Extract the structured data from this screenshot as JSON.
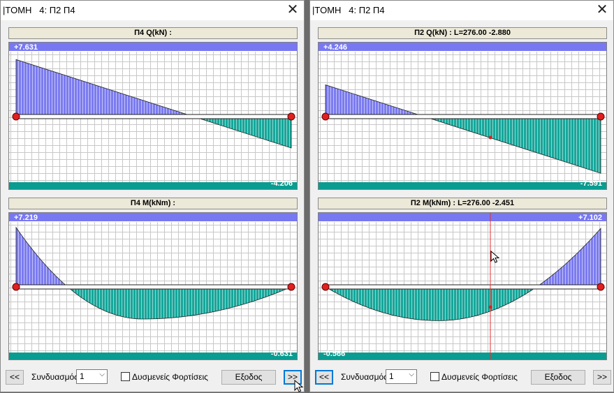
{
  "colors": {
    "blue": "#7b7bf0",
    "teal": "#16a79a",
    "band_blue": "#7878f2",
    "band_teal": "#0a9c90",
    "grid": "#c8c8c8",
    "support": "#e02020",
    "cursor_line": "#e53030"
  },
  "windows": [
    {
      "title": "|ΤΟΜΗ   4: Π2 Π4",
      "close_icon": "close-icon",
      "shear": {
        "header": "Π4 Q(kN) :",
        "top_label": "+7.631",
        "bottom_label": "-4.206"
      },
      "moment": {
        "header": "Π4 M(kNm) :",
        "top_label": "+7.219",
        "bottom_label": "-0.631"
      },
      "controls": {
        "prev": "<<",
        "combo_label": "Συνδυασμός",
        "combo_value": "1",
        "checkbox_label": "Δυσμενείς Φορτίσεις",
        "exit": "Εξοδος",
        "next": ">>"
      }
    },
    {
      "title": "|ΤΟΜΗ   4: Π2 Π4",
      "close_icon": "close-icon",
      "shear": {
        "header": "Π2 Q(kN) : L=276.00 -2.880",
        "top_label": "+4.246",
        "bottom_label": "-7.591"
      },
      "moment": {
        "header": "Π2 M(kNm) : L=276.00 -2.451",
        "top_label": "+7.102",
        "bottom_label": "-0.566"
      },
      "controls": {
        "prev": "<<",
        "combo_label": "Συνδυασμός",
        "combo_value": "1",
        "checkbox_label": "Δυσμενείς Φορτίσεις",
        "exit": "Εξοδος",
        "next": ">>"
      }
    }
  ],
  "chart_data": [
    {
      "type": "line",
      "title": "Π4 Q(kN) :",
      "x": [
        0,
        1
      ],
      "y": [
        7.631,
        -4.206
      ],
      "ylim": [
        -4.206,
        7.631
      ]
    },
    {
      "type": "line",
      "title": "Π4 M(kNm) :",
      "x": [
        0,
        1
      ],
      "kind": "parabola",
      "y_ends": [
        7.219,
        0
      ],
      "y_min": -0.631,
      "y_max": 7.219
    },
    {
      "type": "line",
      "title": "Π2 Q(kN) : L=276.00 -2.880",
      "x": [
        0,
        1
      ],
      "y": [
        4.246,
        -7.591
      ],
      "ylim": [
        -7.591,
        4.246
      ]
    },
    {
      "type": "line",
      "title": "Π2 M(kNm) : L=276.00 -2.451",
      "x": [
        0,
        1
      ],
      "kind": "parabola",
      "y_ends": [
        0,
        7.102
      ],
      "y_min": -0.566,
      "y_max": 7.102
    }
  ]
}
